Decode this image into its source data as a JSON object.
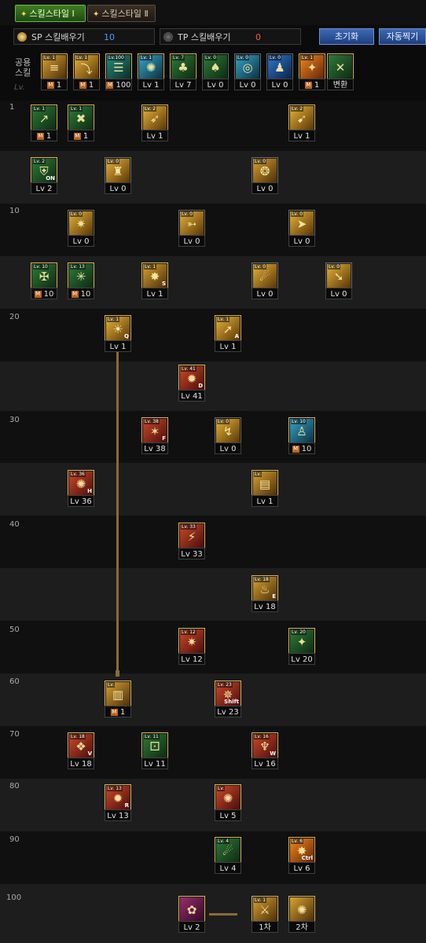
{
  "tabs": [
    {
      "label": "스킬스타일 Ⅰ",
      "icon": "sparkle-icon"
    },
    {
      "label": "스킬스타일 Ⅱ",
      "icon": "sparkle-icon"
    }
  ],
  "points": {
    "sp": {
      "label": "SP 스킬배우기",
      "value": "10"
    },
    "tp": {
      "label": "TP 스킬배우기",
      "value": "0"
    }
  },
  "buttons": {
    "reset": "초기화",
    "auto": "자동찍기"
  },
  "common_skills_label": "공용\n스킬",
  "lv_marker": "Lv.",
  "level_rows": [
    "1",
    "",
    "10",
    "",
    "20",
    "",
    "30",
    "",
    "40",
    "",
    "50",
    "",
    "60",
    "70",
    "80",
    "90",
    "100"
  ],
  "common_skills": [
    {
      "lvtag": "Lv. 1",
      "cap": "1",
      "m": true,
      "art": "gold",
      "glyph": "≡"
    },
    {
      "lvtag": "Lv. 1",
      "cap": "1",
      "m": true,
      "art": "yellow",
      "glyph": "⤵"
    },
    {
      "lvtag": "Lv.100",
      "cap": "100",
      "m": true,
      "art": "teal",
      "glyph": "☰"
    },
    {
      "lvtag": "Lv. 1",
      "cap": "Lv 1",
      "m": false,
      "art": "cyan",
      "glyph": "✺"
    },
    {
      "lvtag": "Lv. 7",
      "cap": "Lv 7",
      "m": false,
      "art": "green",
      "glyph": "♣"
    },
    {
      "lvtag": "Lv. 0",
      "cap": "Lv 0",
      "m": false,
      "art": "green",
      "glyph": "♠"
    },
    {
      "lvtag": "Lv. 0",
      "cap": "Lv 0",
      "m": false,
      "art": "cyan",
      "glyph": "◎"
    },
    {
      "lvtag": "Lv. 0",
      "cap": "Lv 0",
      "m": false,
      "art": "blue",
      "glyph": "♟"
    },
    {
      "lvtag": "Lv. 1",
      "cap": "1",
      "m": true,
      "art": "orange",
      "glyph": "✦"
    },
    {
      "lvtag": "",
      "cap": "변환",
      "m": false,
      "art": "green",
      "glyph": "✕"
    }
  ],
  "skills": [
    {
      "lvtag": "Lv. 1",
      "cap": "1",
      "m": true,
      "art": "green",
      "glyph": "↗",
      "key": ""
    },
    {
      "lvtag": "Lv. 1",
      "cap": "1",
      "m": true,
      "art": "green",
      "glyph": "✖",
      "key": ""
    },
    {
      "lvtag": "Lv. 2",
      "cap": "Lv 1",
      "m": false,
      "art": "yellow",
      "glyph": "➶",
      "key": ""
    },
    {
      "lvtag": "Lv. 2",
      "cap": "Lv 1",
      "m": false,
      "art": "yellow",
      "glyph": "➹",
      "key": ""
    },
    {
      "lvtag": "Lv. 2",
      "cap": "Lv 2",
      "m": false,
      "art": "green",
      "glyph": "⛨",
      "key": "ON"
    },
    {
      "lvtag": "Lv. 0",
      "cap": "Lv 0",
      "m": false,
      "art": "yellow",
      "glyph": "♜",
      "key": ""
    },
    {
      "lvtag": "Lv. 0",
      "cap": "Lv 0",
      "m": false,
      "art": "gold",
      "glyph": "❂",
      "key": ""
    },
    {
      "lvtag": "Lv. 0",
      "cap": "Lv 0",
      "m": false,
      "art": "yellow",
      "glyph": "✷",
      "key": ""
    },
    {
      "lvtag": "Lv. 0",
      "cap": "Lv 0",
      "m": false,
      "art": "yellow",
      "glyph": "➳",
      "key": ""
    },
    {
      "lvtag": "Lv. 0",
      "cap": "Lv 0",
      "m": false,
      "art": "yellow",
      "glyph": "➤",
      "key": ""
    },
    {
      "lvtag": "Lv. 10",
      "cap": "10",
      "m": true,
      "art": "green",
      "glyph": "✠",
      "key": ""
    },
    {
      "lvtag": "Lv. 13",
      "cap": "10",
      "m": true,
      "art": "green",
      "glyph": "✳",
      "key": ""
    },
    {
      "lvtag": "Lv. 1",
      "cap": "Lv 1",
      "m": false,
      "art": "gold",
      "glyph": "✸",
      "key": "S"
    },
    {
      "lvtag": "Lv. 0",
      "cap": "Lv 0",
      "m": false,
      "art": "yellow",
      "glyph": "☄",
      "key": ""
    },
    {
      "lvtag": "Lv. 0",
      "cap": "Lv 0",
      "m": false,
      "art": "yellow",
      "glyph": "➘",
      "key": ""
    },
    {
      "lvtag": "Lv. 1",
      "cap": "Lv 1",
      "m": false,
      "art": "yellow",
      "glyph": "☀",
      "key": "Q"
    },
    {
      "lvtag": "Lv. 1",
      "cap": "Lv 1",
      "m": false,
      "art": "yellow",
      "glyph": "➚",
      "key": "A"
    },
    {
      "lvtag": "Lv. 41",
      "cap": "Lv 41",
      "m": false,
      "art": "red",
      "glyph": "✹",
      "key": "D"
    },
    {
      "lvtag": "Lv. 38",
      "cap": "Lv 38",
      "m": false,
      "art": "red",
      "glyph": "✶",
      "key": "F"
    },
    {
      "lvtag": "Lv. 0",
      "cap": "Lv 0",
      "m": false,
      "art": "yellow",
      "glyph": "↯",
      "key": ""
    },
    {
      "lvtag": "Lv. 10",
      "cap": "10",
      "m": true,
      "art": "cyan",
      "glyph": "♙",
      "key": ""
    },
    {
      "lvtag": "Lv. 36",
      "cap": "Lv 36",
      "m": false,
      "art": "red",
      "glyph": "✺",
      "key": "H"
    },
    {
      "lvtag": "Lv.",
      "cap": "Lv 1",
      "m": false,
      "art": "gold",
      "glyph": "▤",
      "key": ""
    },
    {
      "lvtag": "Lv. 33",
      "cap": "Lv 33",
      "m": false,
      "art": "red",
      "glyph": "⚡",
      "key": ""
    },
    {
      "lvtag": "Lv. 18",
      "cap": "Lv 18",
      "m": false,
      "art": "gold",
      "glyph": "♨",
      "key": "E"
    },
    {
      "lvtag": "Lv. 12",
      "cap": "Lv 12",
      "m": false,
      "art": "red",
      "glyph": "✷",
      "key": ""
    },
    {
      "lvtag": "Lv. 20",
      "cap": "Lv 20",
      "m": false,
      "art": "green",
      "glyph": "✦",
      "key": ""
    },
    {
      "lvtag": "Lv.",
      "cap": "1",
      "m": true,
      "art": "gold",
      "glyph": "▥",
      "key": ""
    },
    {
      "lvtag": "Lv. 23",
      "cap": "Lv 23",
      "m": false,
      "art": "red",
      "glyph": "✵",
      "key": "Shift"
    },
    {
      "lvtag": "Lv. 18",
      "cap": "Lv 18",
      "m": false,
      "art": "red",
      "glyph": "❖",
      "key": "V"
    },
    {
      "lvtag": "Lv. 11",
      "cap": "Lv 11",
      "m": false,
      "art": "green",
      "glyph": "⚀",
      "key": ""
    },
    {
      "lvtag": "Lv. 16",
      "cap": "Lv 16",
      "m": false,
      "art": "red",
      "glyph": "♆",
      "key": "W"
    },
    {
      "lvtag": "Lv. 13",
      "cap": "Lv 13",
      "m": false,
      "art": "red",
      "glyph": "✹",
      "key": "R"
    },
    {
      "lvtag": "Lv.",
      "cap": "Lv 5",
      "m": false,
      "art": "red",
      "glyph": "✺",
      "key": ""
    },
    {
      "lvtag": "Lv. 4",
      "cap": "Lv 4",
      "m": false,
      "art": "green",
      "glyph": "☄",
      "key": ""
    },
    {
      "lvtag": "Lv. 6",
      "cap": "Lv 6",
      "m": false,
      "art": "orange",
      "glyph": "✸",
      "key": "Ctrl"
    },
    {
      "lvtag": "",
      "cap": "Lv 2",
      "m": false,
      "art": "purple",
      "glyph": "✿",
      "key": ""
    },
    {
      "lvtag": "Lv. 1",
      "cap": "1차",
      "m": false,
      "art": "gold",
      "glyph": "⚔",
      "key": ""
    },
    {
      "lvtag": "",
      "cap": "2차",
      "m": false,
      "art": "gold",
      "glyph": "✺",
      "key": ""
    }
  ],
  "colors": {
    "accent": "#3da0ff",
    "tp": "#ff5a3a",
    "connector": "#8a6a3a"
  }
}
